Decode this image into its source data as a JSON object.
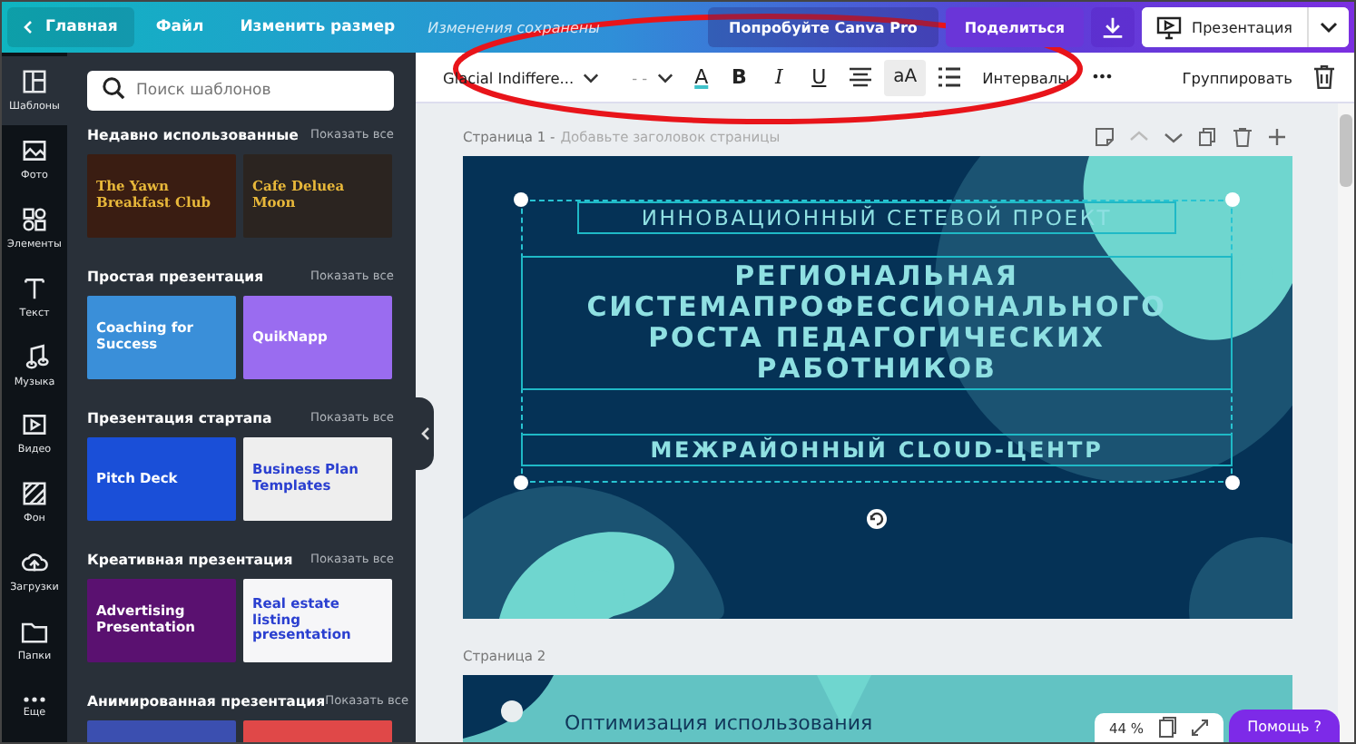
{
  "topbar": {
    "home": "Главная",
    "menu": [
      "Файл",
      "Изменить размер"
    ],
    "save_status": "Изменения сохранены",
    "pro_button": "Попробуйте Canva Pro",
    "share": "Поделиться",
    "present": "Презентация"
  },
  "rail": [
    {
      "label": "Шаблоны",
      "selected": true
    },
    {
      "label": "Фото",
      "selected": false
    },
    {
      "label": "Элементы",
      "selected": false
    },
    {
      "label": "Текст",
      "selected": false
    },
    {
      "label": "Музыка",
      "selected": false
    },
    {
      "label": "Видео",
      "selected": false
    },
    {
      "label": "Фон",
      "selected": false
    },
    {
      "label": "Загрузки",
      "selected": false
    },
    {
      "label": "Папки",
      "selected": false
    },
    {
      "label": "Еще",
      "selected": false
    }
  ],
  "search": {
    "placeholder": "Поиск шаблонов"
  },
  "sections": [
    {
      "title": "Недавно использованные",
      "show_all": "Показать все",
      "templates": [
        {
          "title": "The Yawn Breakfast Club",
          "color": "#3a1d12"
        },
        {
          "title": "Cafe Deluea Moon",
          "color": "#2b2420"
        }
      ]
    },
    {
      "title": "Простая презентация",
      "show_all": "Показать все",
      "templates": [
        {
          "title": "Coaching for Success",
          "color": "#3a8fd9"
        },
        {
          "title": "QuikNapp",
          "color": "#9a6cf0"
        }
      ]
    },
    {
      "title": "Презентация стартапа",
      "show_all": "Показать все",
      "templates": [
        {
          "title": "Pitch Deck",
          "color": "#1a4fd8"
        },
        {
          "title": "Business Plan Templates",
          "color": "#eeeeee"
        }
      ]
    },
    {
      "title": "Креативная презентация",
      "show_all": "Показать все",
      "templates": [
        {
          "title": "Advertising Presentation",
          "color": "#5a1170"
        },
        {
          "title": "Real estate listing presentation",
          "color": "#f6f6f8"
        }
      ]
    },
    {
      "title": "Анимированная презентация",
      "show_all": "Показать все",
      "templates": [
        {
          "color": "#3b4fb0"
        },
        {
          "color": "#e04848"
        }
      ]
    }
  ],
  "toolbar": {
    "font": "Glacial Indiffere...",
    "size": "- -",
    "text_color": "A",
    "format": [
      "B",
      "I",
      "U"
    ],
    "case": "aA",
    "spacing": "Интервалы",
    "more": "•••",
    "group": "Группировать"
  },
  "pages": [
    {
      "label": "Страница 1 -",
      "hint": "Добавьте заголовок страницы",
      "texts": [
        "ИННОВАЦИОННЫЙ СЕТЕВОЙ ПРОЕКТ",
        "РЕГИОНАЛЬНАЯ СИСТЕМАПРОФЕССИОНАЛЬНОГО РОСТА ПЕДАГОГИЧЕСКИХ РАБОТНИКОВ",
        "МЕЖРАЙОННЫЙ CLOUD-ЦЕНТР"
      ]
    },
    {
      "label": "Страница 2",
      "texts": [
        "Оптимизация использования"
      ]
    }
  ],
  "zoom": "44 %",
  "help": "Помощь ?"
}
